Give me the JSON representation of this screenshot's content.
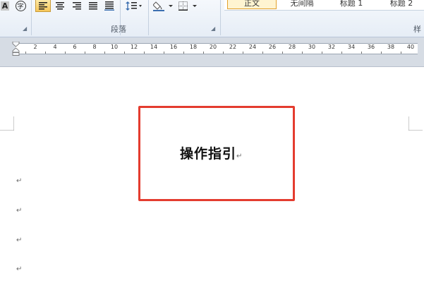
{
  "ribbon": {
    "font_group": {
      "char_shading_glyph": "A",
      "enclosed_char_glyph": "字"
    },
    "paragraph_group": {
      "label": "段落",
      "align_left": "align-left-icon",
      "align_center": "align-center-icon",
      "align_right": "align-right-icon",
      "justify": "justify-icon",
      "distributed": "distributed-icon",
      "line_spacing": "line-spacing-icon",
      "shading": "shading-icon",
      "borders": "borders-icon"
    },
    "styles_group": {
      "label_partial": "样",
      "items": [
        "正文",
        "无间隔",
        "标题 1",
        "标题 2"
      ]
    }
  },
  "ruler": {
    "numbers": [
      "2",
      "4",
      "6",
      "8",
      "10",
      "12",
      "14",
      "16",
      "18",
      "20",
      "22",
      "24",
      "26",
      "28",
      "30",
      "32",
      "34",
      "36",
      "38",
      "40"
    ]
  },
  "document": {
    "heading": "操作指引",
    "paragraph_mark": "↵"
  },
  "colors": {
    "highlight_box": "#e43c2f",
    "active_button": "#f7c75a"
  }
}
